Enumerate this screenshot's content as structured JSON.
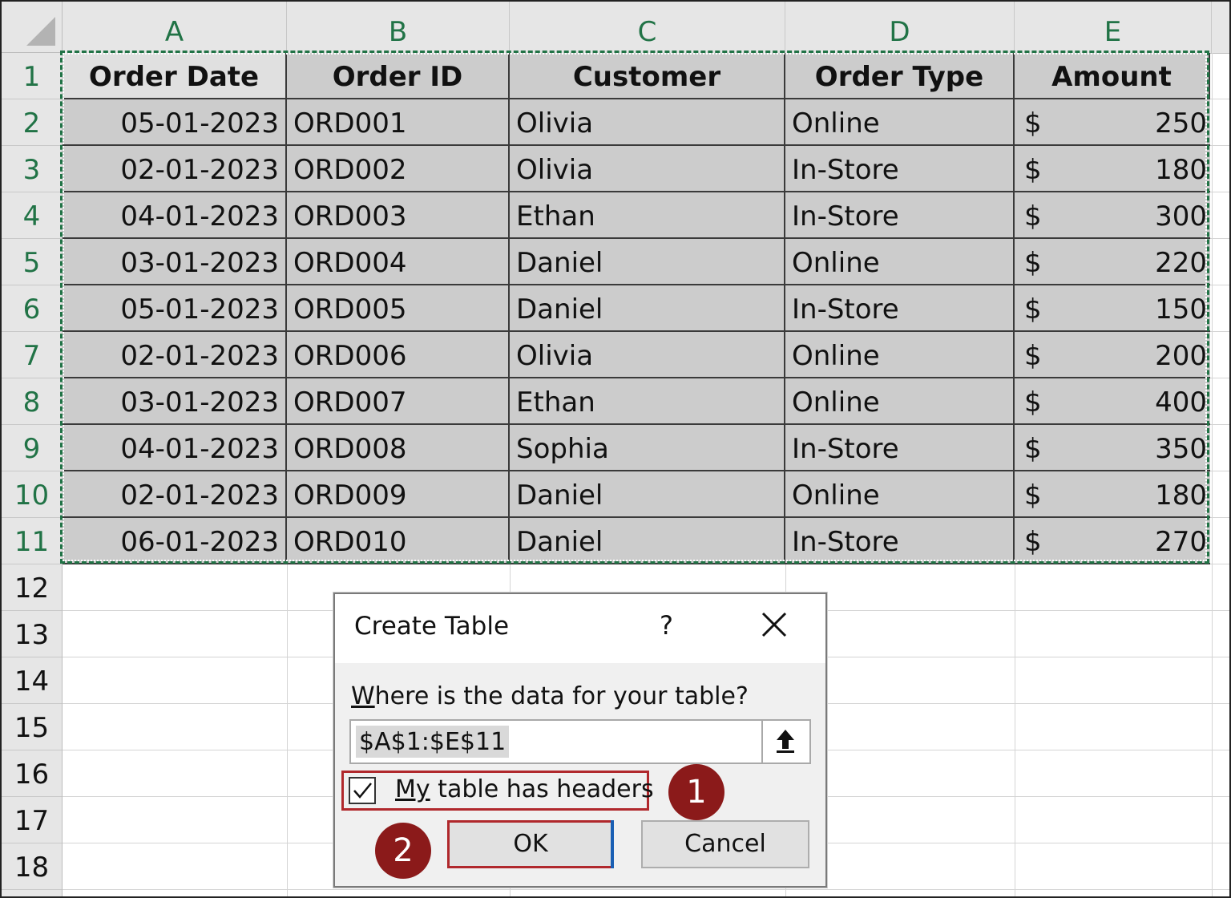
{
  "columns": [
    "A",
    "B",
    "C",
    "D",
    "E"
  ],
  "rows": [
    "1",
    "2",
    "3",
    "4",
    "5",
    "6",
    "7",
    "8",
    "9",
    "10",
    "11",
    "12",
    "13",
    "14",
    "15",
    "16",
    "17",
    "18"
  ],
  "table": {
    "headers": [
      "Order Date",
      "Order ID",
      "Customer",
      "Order Type",
      "Amount"
    ],
    "currency_symbol": "$",
    "records": [
      {
        "date": "05-01-2023",
        "id": "ORD001",
        "customer": "Olivia",
        "type": "Online",
        "amount": "250"
      },
      {
        "date": "02-01-2023",
        "id": "ORD002",
        "customer": "Olivia",
        "type": "In-Store",
        "amount": "180"
      },
      {
        "date": "04-01-2023",
        "id": "ORD003",
        "customer": "Ethan",
        "type": "In-Store",
        "amount": "300"
      },
      {
        "date": "03-01-2023",
        "id": "ORD004",
        "customer": "Daniel",
        "type": "Online",
        "amount": "220"
      },
      {
        "date": "05-01-2023",
        "id": "ORD005",
        "customer": "Daniel",
        "type": "In-Store",
        "amount": "150"
      },
      {
        "date": "02-01-2023",
        "id": "ORD006",
        "customer": "Olivia",
        "type": "Online",
        "amount": "200"
      },
      {
        "date": "03-01-2023",
        "id": "ORD007",
        "customer": "Ethan",
        "type": "Online",
        "amount": "400"
      },
      {
        "date": "04-01-2023",
        "id": "ORD008",
        "customer": "Sophia",
        "type": "In-Store",
        "amount": "350"
      },
      {
        "date": "02-01-2023",
        "id": "ORD009",
        "customer": "Daniel",
        "type": "Online",
        "amount": "180"
      },
      {
        "date": "06-01-2023",
        "id": "ORD010",
        "customer": "Daniel",
        "type": "In-Store",
        "amount": "270"
      }
    ]
  },
  "dialog": {
    "title": "Create Table",
    "help_label": "?",
    "prompt": "Where is the data for your table?",
    "range_value": "$A$1:$E$11",
    "headers_checkbox_label": "My table has headers",
    "headers_checked": true,
    "ok_label": "OK",
    "cancel_label": "Cancel"
  },
  "annotations": {
    "step1": "1",
    "step2": "2"
  },
  "colors": {
    "selection": "#217346",
    "highlight": "#b0282c",
    "badge": "#8b1a1a"
  }
}
